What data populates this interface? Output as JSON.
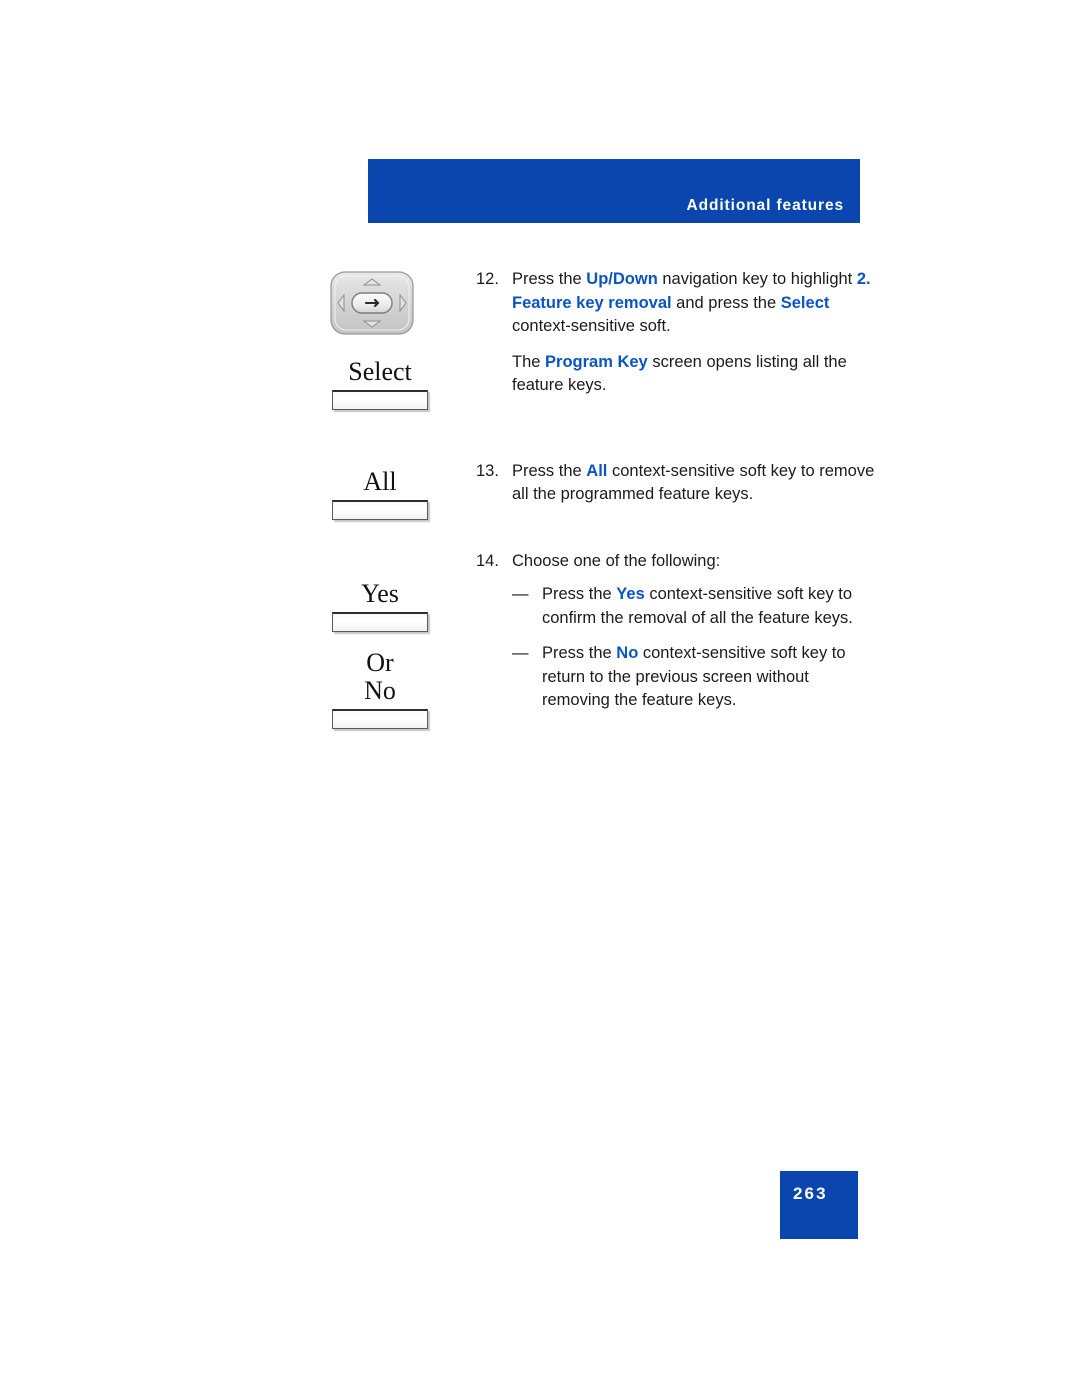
{
  "header": {
    "title": "Additional features",
    "bar_color": "#0A46AE"
  },
  "colors": {
    "accent_blue": "#0A46AE",
    "highlight_blue": "#0B54C4",
    "body_text": "#1b1b1b"
  },
  "left_column": {
    "nav_key": {
      "icon": "navigation-cluster-icon",
      "directions": [
        "up",
        "down",
        "left",
        "right",
        "enter"
      ]
    },
    "softkeys": [
      {
        "label": "Select",
        "name": "softkey-select"
      },
      {
        "label": "All",
        "name": "softkey-all"
      },
      {
        "label": "Yes",
        "name": "softkey-yes"
      },
      {
        "label": "No",
        "name": "softkey-no"
      }
    ],
    "or_label": "Or"
  },
  "steps": [
    {
      "number": "12.",
      "segments": [
        {
          "text": "Press the ",
          "bold": false
        },
        {
          "text": "Up/Down",
          "bold": true
        },
        {
          "text": " navigation key to highlight ",
          "bold": false
        },
        {
          "text": "2. Feature key removal",
          "bold": true
        },
        {
          "text": " and press the ",
          "bold": false
        },
        {
          "text": "Select",
          "bold": true
        },
        {
          "text": " context-sensitive soft.",
          "bold": false
        }
      ],
      "paragraph": [
        {
          "text": "The ",
          "bold": false
        },
        {
          "text": "Program Key",
          "bold": true
        },
        {
          "text": " screen opens listing all the feature keys.",
          "bold": false
        }
      ]
    },
    {
      "number": "13.",
      "segments": [
        {
          "text": "Press the ",
          "bold": false
        },
        {
          "text": "All",
          "bold": true
        },
        {
          "text": " context-sensitive soft key to remove all the programmed feature keys.",
          "bold": false
        }
      ]
    },
    {
      "number": "14.",
      "segments": [
        {
          "text": "Choose one of the following:",
          "bold": false
        }
      ],
      "sub_items": [
        {
          "dash": "—",
          "segments": [
            {
              "text": "Press the ",
              "bold": false
            },
            {
              "text": "Yes",
              "bold": true
            },
            {
              "text": " context-sensitive soft key to confirm the removal of all the feature keys.",
              "bold": false
            }
          ]
        },
        {
          "dash": "—",
          "segments": [
            {
              "text": "Press the ",
              "bold": false
            },
            {
              "text": "No",
              "bold": true
            },
            {
              "text": " context-sensitive soft key to return to the previous screen without removing the feature keys.",
              "bold": false
            }
          ]
        }
      ]
    }
  ],
  "footer": {
    "page_number": "263"
  }
}
